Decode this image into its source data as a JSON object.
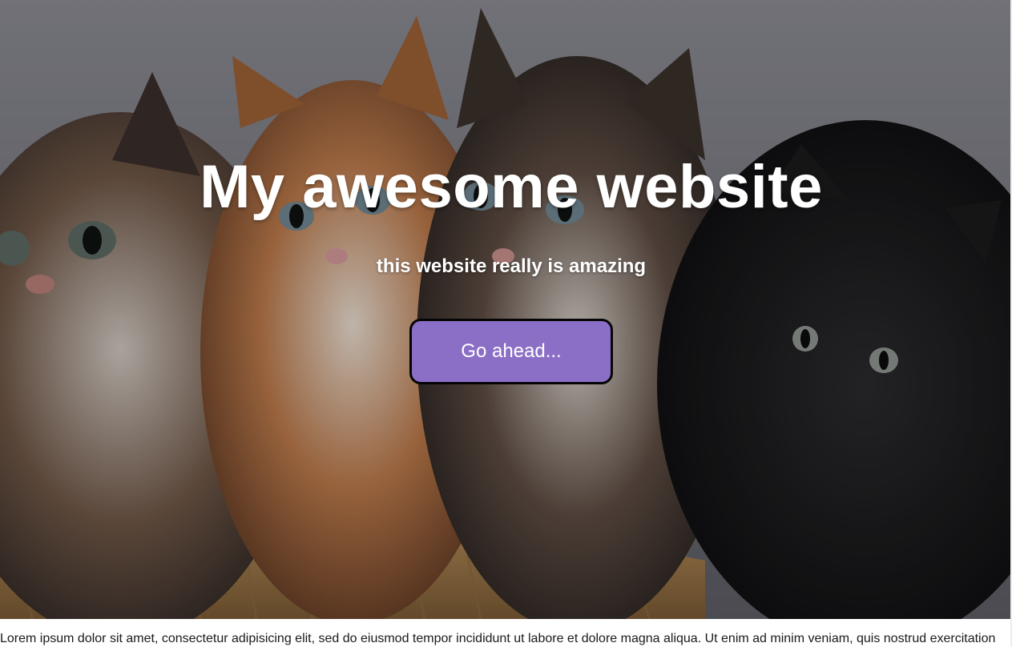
{
  "hero": {
    "title": "My awesome website",
    "subtitle": "this website really is amazing",
    "button_label": "Go ahead...",
    "image": "kittens-photo",
    "accent_color": "#8b6fc6"
  },
  "body": {
    "paragraph": "Lorem ipsum dolor sit amet, consectetur adipisicing elit, sed do eiusmod tempor incididunt ut labore et dolore magna aliqua. Ut enim ad minim veniam, quis nostrud exercitation"
  }
}
